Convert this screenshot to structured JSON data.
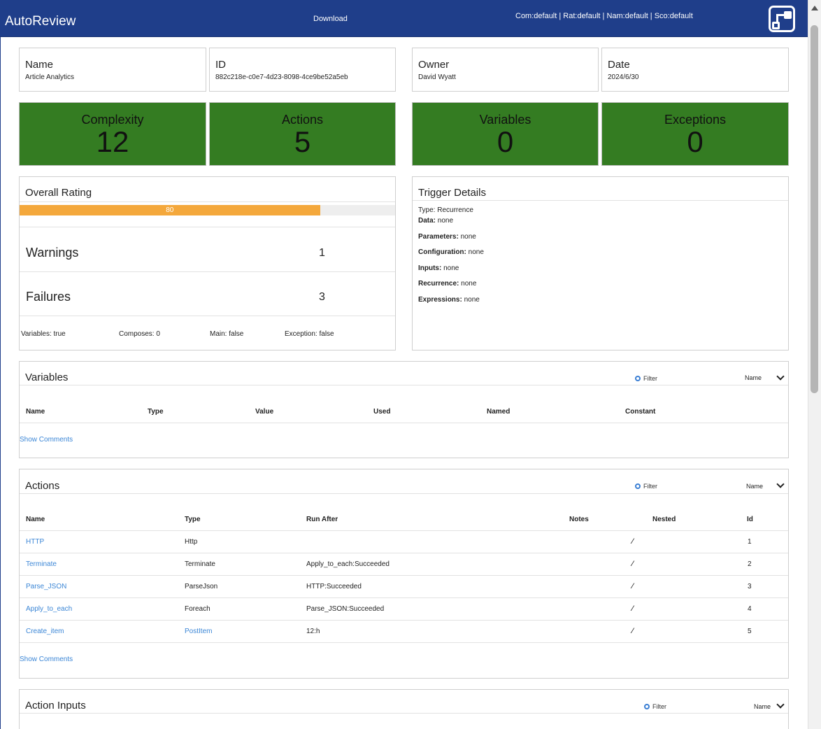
{
  "header": {
    "brand": "AutoReview",
    "download": "Download",
    "settings": "Com:default | Rat:default | Nam:default | Sco:default",
    "logo_icon": "flow-logo-icon"
  },
  "info": {
    "name_label": "Name",
    "name_value": "Article Analytics",
    "id_label": "ID",
    "id_value": "882c218e-c0e7-4d23-8098-4ce9be52a5eb",
    "owner_label": "Owner",
    "owner_value": "David Wyatt",
    "date_label": "Date",
    "date_value": "2024/6/30"
  },
  "stats": {
    "complexity_label": "Complexity",
    "complexity_value": "12",
    "actions_label": "Actions",
    "actions_value": "5",
    "variables_label": "Variables",
    "variables_value": "0",
    "exceptions_label": "Exceptions",
    "exceptions_value": "0",
    "box_color": "#347c22"
  },
  "rating": {
    "title": "Overall Rating",
    "score": 80,
    "score_text": "80",
    "bar_color": "#f4a83c",
    "warnings_label": "Warnings",
    "warnings_value": "1",
    "failures_label": "Failures",
    "failures_value": "3",
    "footer": {
      "variables": "Variables: true",
      "composes": "Composes: 0",
      "main": "Main: false",
      "exception": "Exception: false"
    }
  },
  "trigger": {
    "title": "Trigger Details",
    "type_line": "Type: Recurrence",
    "data_label": "Data:",
    "data_value": " none",
    "parameters_label": "Parameters:",
    "parameters_value": " none",
    "configuration_label": "Configuration:",
    "configuration_value": " none",
    "inputs_label": "Inputs:",
    "inputs_value": " none",
    "recurrence_label": "Recurrence:",
    "recurrence_value": " none",
    "expressions_label": "Expressions:",
    "expressions_value": " none"
  },
  "variables_panel": {
    "title": "Variables",
    "filter": "Filter",
    "sort": "Name",
    "columns": [
      "Name",
      "Type",
      "Value",
      "Used",
      "Named",
      "Constant"
    ],
    "show_comments": "Show Comments"
  },
  "actions_panel": {
    "title": "Actions",
    "filter": "Filter",
    "sort": "Name",
    "columns": [
      "Name",
      "Type",
      "Run After",
      "Notes",
      "Nested",
      "Id"
    ],
    "rows": [
      {
        "name": "HTTP",
        "type": "Http",
        "run_after": "",
        "id": "1"
      },
      {
        "name": "Terminate",
        "type": "Terminate",
        "run_after": "Apply_to_each:Succeeded",
        "id": "2"
      },
      {
        "name": "Parse_JSON",
        "type": "ParseJson",
        "run_after": "HTTP:Succeeded",
        "id": "3"
      },
      {
        "name": "Apply_to_each",
        "type": "Foreach",
        "run_after": "Parse_JSON:Succeeded",
        "id": "4"
      },
      {
        "name": "Create_item",
        "type": "PostItem",
        "run_after": "12:h",
        "id": "5"
      }
    ],
    "notes_icon": "edit-note-icon",
    "show_comments": "Show Comments"
  },
  "inputs_panel": {
    "title": "Action Inputs",
    "filter": "Filter",
    "sort": "Name"
  }
}
